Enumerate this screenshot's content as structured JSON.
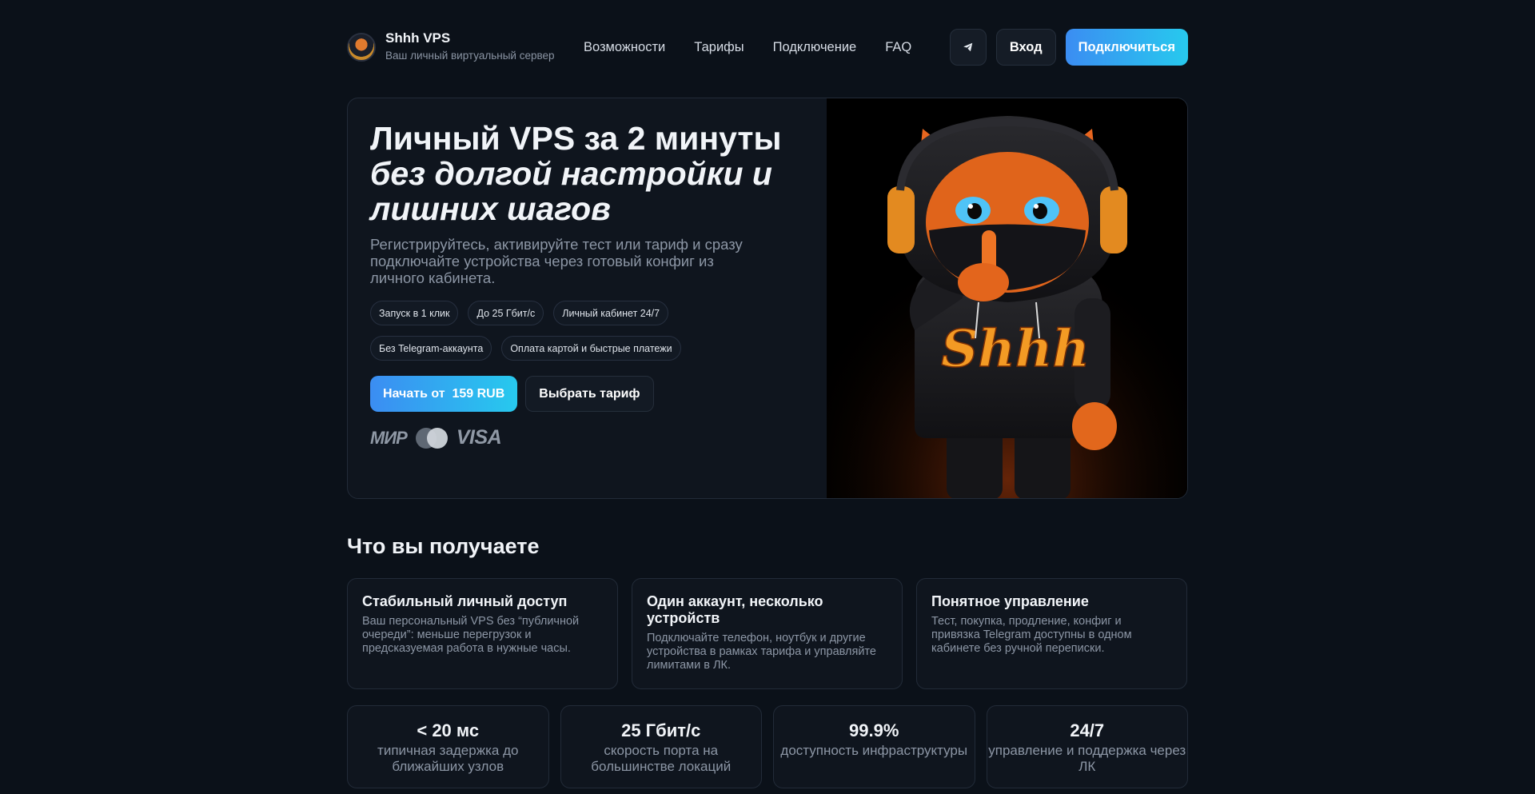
{
  "brand": {
    "name": "Shhh VPS",
    "subtitle": "Ваш личный виртуальный сервер"
  },
  "nav": [
    "Возможности",
    "Тарифы",
    "Подключение",
    "FAQ"
  ],
  "header_actions": {
    "telegram_icon": "telegram-icon",
    "login": "Вход",
    "connect": "Подключиться"
  },
  "hero": {
    "title_line1": "Личный VPS за 2 минуты",
    "title_line2": "без долгой настройки и лишних шагов",
    "description": "Регистрируйтесь, активируйте тест или тариф и сразу подключайте устройства через готовый конфиг из личного кабинета.",
    "chips": [
      "Запуск в 1 клик",
      "До 25 Гбит/с",
      "Личный кабинет 24/7",
      "Без Telegram-аккаунта",
      "Оплата картой и быстрые платежи"
    ],
    "start_button": "Начать от  159 RUB",
    "choose_button": "Выбрать тариф",
    "payments": {
      "mir": "МИР",
      "visa": "VISA"
    },
    "mascot_text": "Shhh"
  },
  "section_title": "Что вы получаете",
  "features": [
    {
      "title": "Стабильный личный доступ",
      "desc": "Ваш персональный VPS без “публичной очереди”: меньше перегрузок и предсказуемая работа в нужные часы."
    },
    {
      "title": "Один аккаунт, несколько устройств",
      "desc": "Подключайте телефон, ноутбук и другие устройства в рамках тарифа и управляйте лимитами в ЛК."
    },
    {
      "title": "Понятное управление",
      "desc": "Тест, покупка, продление, конфиг и привязка Telegram доступны в одном кабинете без ручной переписки."
    }
  ],
  "stats": [
    {
      "value": "< 20 мс",
      "label": "типичная задержка до ближайших узлов"
    },
    {
      "value": "25 Гбит/с",
      "label": "скорость порта на большинстве локаций"
    },
    {
      "value": "99.9%",
      "label": "доступность инфраструктуры"
    },
    {
      "value": "24/7",
      "label": "управление и поддержка через ЛК"
    }
  ]
}
